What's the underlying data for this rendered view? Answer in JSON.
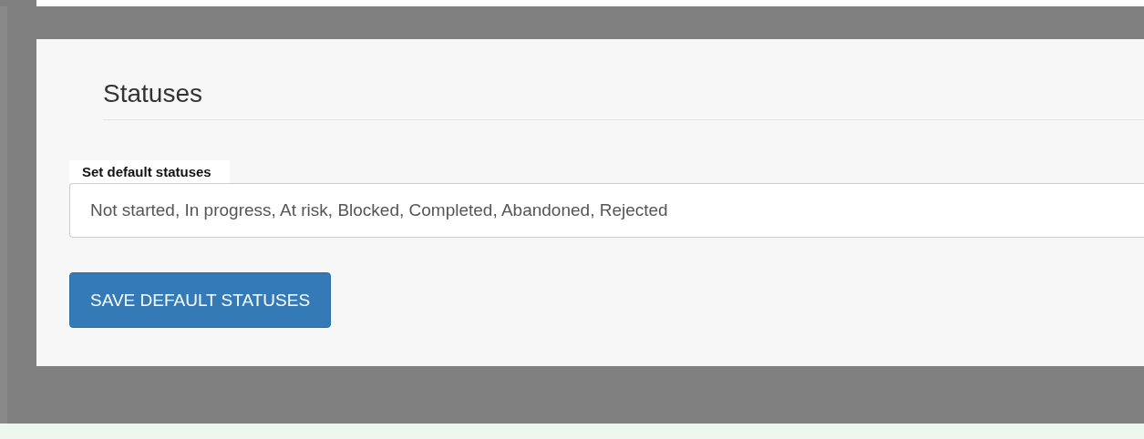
{
  "section": {
    "title": "Statuses"
  },
  "field": {
    "label": "Set default statuses",
    "value": "Not started, In progress, At risk, Blocked, Completed, Abandoned, Rejected"
  },
  "buttons": [
    {
      "label": "SAVE DEFAULT STATUSES",
      "kind": "primary"
    }
  ]
}
